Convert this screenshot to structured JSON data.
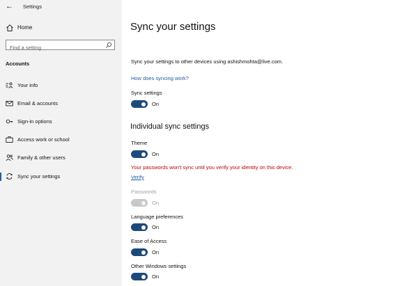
{
  "window": {
    "title": "Settings"
  },
  "sidebar": {
    "home": "Home",
    "search_placeholder": "Find a setting",
    "section": "Accounts",
    "items": [
      {
        "label": "Your info",
        "icon": "person-list-icon"
      },
      {
        "label": "Email & accounts",
        "icon": "mail-icon"
      },
      {
        "label": "Sign-in options",
        "icon": "key-icon"
      },
      {
        "label": "Access work or school",
        "icon": "briefcase-icon"
      },
      {
        "label": "Family & other users",
        "icon": "people-icon"
      },
      {
        "label": "Sync your settings",
        "icon": "sync-icon",
        "active": true
      }
    ]
  },
  "main": {
    "title": "Sync your settings",
    "description": "Sync your settings to other devices using ashishmohta@live.com.",
    "help_link": "How does syncing work?",
    "sync_settings": {
      "label": "Sync settings",
      "state": "On"
    },
    "individual_heading": "Individual sync settings",
    "theme": {
      "label": "Theme",
      "state": "On"
    },
    "warning": "Your passwords won't sync until you verify your identity on this device.",
    "verify_link": "Verify",
    "passwords": {
      "label": "Passwords",
      "state": "On"
    },
    "language": {
      "label": "Language preferences",
      "state": "On"
    },
    "ease": {
      "label": "Ease of Access",
      "state": "On"
    },
    "other": {
      "label": "Other Windows settings",
      "state": "On"
    }
  },
  "colors": {
    "accent": "#1c4a7a",
    "link": "#1e5a96",
    "warning": "#c00000",
    "sidebar_bg": "#f2f2f2"
  }
}
